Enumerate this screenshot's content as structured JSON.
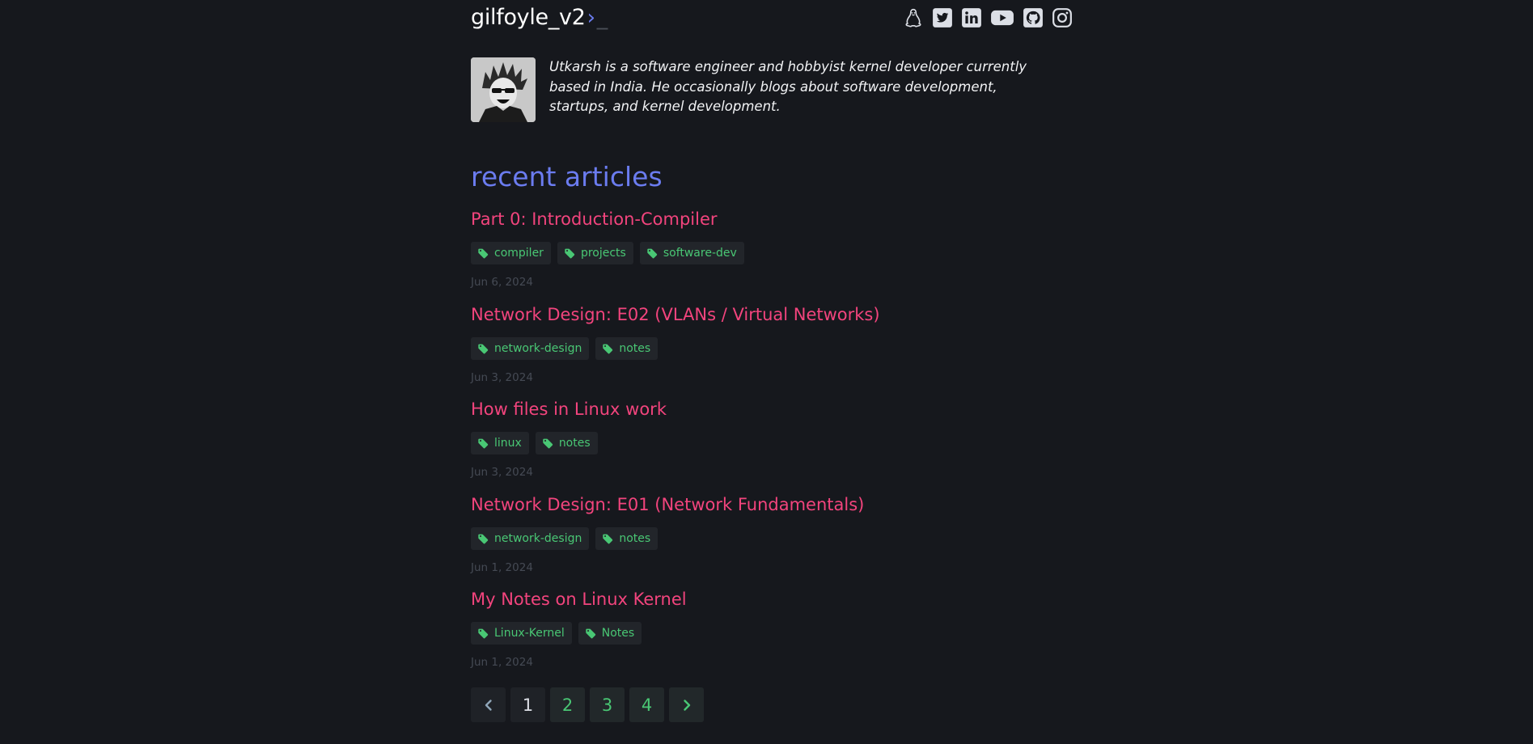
{
  "site": {
    "title": "gilfoyle_v2",
    "prompt_glyph": "›",
    "cursor": "_"
  },
  "social": [
    {
      "icon": "linux-tux-icon"
    },
    {
      "icon": "twitter-icon"
    },
    {
      "icon": "linkedin-icon"
    },
    {
      "icon": "youtube-icon"
    },
    {
      "icon": "github-icon"
    },
    {
      "icon": "instagram-icon"
    }
  ],
  "profile": {
    "bio": "Utkarsh is a software engineer and hobbyist kernel developer currently based in India. He occasionally blogs about software development, startups, and kernel development."
  },
  "section_title": "recent articles",
  "articles": [
    {
      "title": "Part 0: Introduction-Compiler",
      "tags": [
        "compiler",
        "projects",
        "software-dev"
      ],
      "date": "Jun 6, 2024"
    },
    {
      "title": "Network Design: E02 (VLANs / Virtual Networks)",
      "tags": [
        "network-design",
        "notes"
      ],
      "date": "Jun 3, 2024"
    },
    {
      "title": "How files in Linux work",
      "tags": [
        "linux",
        "notes"
      ],
      "date": "Jun 3, 2024"
    },
    {
      "title": "Network Design: E01 (Network Fundamentals)",
      "tags": [
        "network-design",
        "notes"
      ],
      "date": "Jun 1, 2024"
    },
    {
      "title": "My Notes on Linux Kernel",
      "tags": [
        "Linux-Kernel",
        "Notes"
      ],
      "date": "Jun 1, 2024"
    }
  ],
  "pagination": {
    "pages": [
      "1",
      "2",
      "3",
      "4"
    ],
    "current": "1"
  },
  "colors": {
    "background": "#16181d",
    "accent": "#6b7cf0",
    "article_title": "#f2447d",
    "tag_text": "#49c774",
    "date": "#454a54"
  }
}
